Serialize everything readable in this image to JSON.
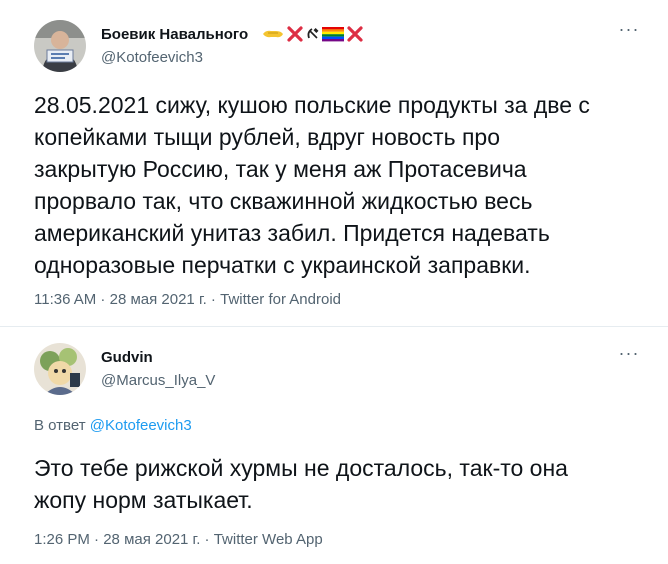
{
  "tweets": [
    {
      "author": {
        "display_name": "Боевик Навального",
        "handle": "@Kotofeevich3",
        "name_emoji": [
          "handshake-icon",
          "cross-mark-icon",
          "hammer-sickle-icon",
          "rainbow-flag-icon",
          "cross-mark-icon"
        ]
      },
      "text": "28.05.2021 сижу, кушою польские продукты за две с\nкопейками тыщи рублей, вдруг новость про\nзакрытую Россию, так у меня аж Протасевича\nпрорвало так, что скважинной жидкостью весь\nамериканский унитаз забил. Придется надевать\nодноразовые перчатки с украинской заправки.",
      "time": "11:36 AM",
      "separator": " · ",
      "date": "28 мая 2021 г.",
      "source": "Twitter for Android",
      "more_label": "···"
    },
    {
      "author": {
        "display_name": "Gudvin",
        "handle": "@Marcus_Ilya_V"
      },
      "reply_prefix": "В ответ",
      "reply_to": "@Kotofeevich3",
      "text": "Это тебе рижской хурмы не досталось, так-то она\nжопу норм затыкает.",
      "time": "1:26 PM",
      "separator": " · ",
      "date": "28 мая 2021 г.",
      "source": "Twitter Web App",
      "more_label": "···"
    }
  ],
  "colors": {
    "text_primary": "#0f1419",
    "text_secondary": "#536471",
    "link": "#1d9bf0",
    "divider": "#e6ecf0",
    "background": "#ffffff"
  }
}
